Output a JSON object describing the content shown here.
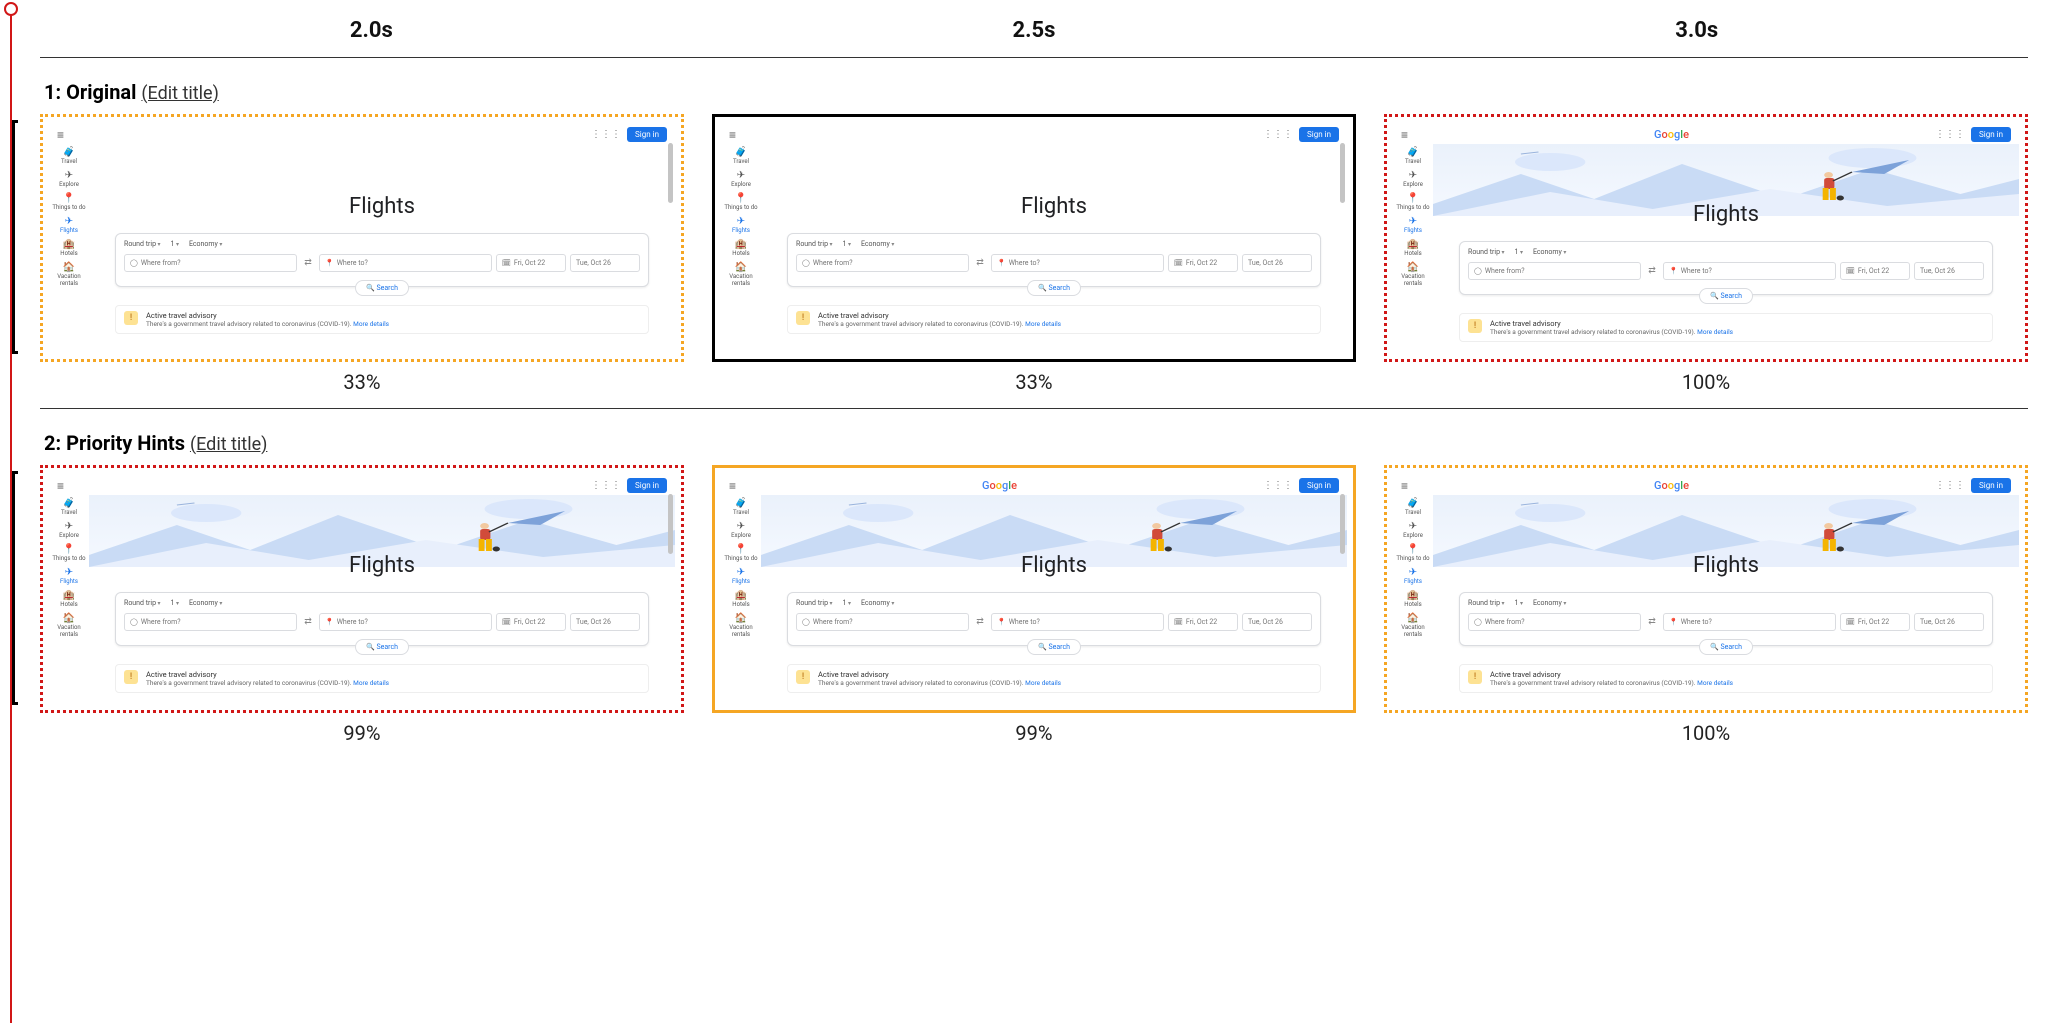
{
  "timeline": {
    "headers": [
      "2.0s",
      "2.5s",
      "3.0s"
    ]
  },
  "ui_text": {
    "edit_title": "(Edit title)"
  },
  "rows": [
    {
      "index": "1",
      "title": "Original",
      "frames": [
        {
          "border": "dotted-orange",
          "percent": "33%",
          "showHero": false,
          "showLogo": false,
          "showScrollbar": true
        },
        {
          "border": "solid-black",
          "percent": "33%",
          "showHero": false,
          "showLogo": false,
          "showScrollbar": true
        },
        {
          "border": "dotted-red",
          "percent": "100%",
          "showHero": true,
          "showLogo": true,
          "showScrollbar": false
        }
      ]
    },
    {
      "index": "2",
      "title": "Priority Hints",
      "frames": [
        {
          "border": "dotted-red",
          "percent": "99%",
          "showHero": true,
          "showLogo": false,
          "showScrollbar": true
        },
        {
          "border": "solid-orange",
          "percent": "99%",
          "showHero": true,
          "showLogo": true,
          "showScrollbar": true
        },
        {
          "border": "dotted-orange",
          "percent": "100%",
          "showHero": true,
          "showLogo": true,
          "showScrollbar": false
        }
      ]
    }
  ],
  "site": {
    "logo_letters": [
      "G",
      "o",
      "o",
      "g",
      "l",
      "e"
    ],
    "sign_in": "Sign in",
    "nav": [
      {
        "icon": "🧳",
        "label": "Travel",
        "active": false
      },
      {
        "icon": "✈",
        "label": "Explore",
        "active": false
      },
      {
        "icon": "📍",
        "label": "Things to do",
        "active": false
      },
      {
        "icon": "✈",
        "label": "Flights",
        "active": true
      },
      {
        "icon": "🏨",
        "label": "Hotels",
        "active": false
      },
      {
        "icon": "🏠",
        "label": "Vacation rentals",
        "active": false
      }
    ],
    "page_title": "Flights",
    "options": {
      "trip": "Round trip",
      "pax": "1",
      "class": "Economy"
    },
    "fields": {
      "from_placeholder": "Where from?",
      "to_placeholder": "Where to?",
      "date1": "Fri, Oct 22",
      "date2": "Tue, Oct 26"
    },
    "search_label": "Search",
    "advisory": {
      "title": "Active travel advisory",
      "subtitle": "There's a government travel advisory related to coronavirus (COVID-19).",
      "more": "More details"
    }
  }
}
